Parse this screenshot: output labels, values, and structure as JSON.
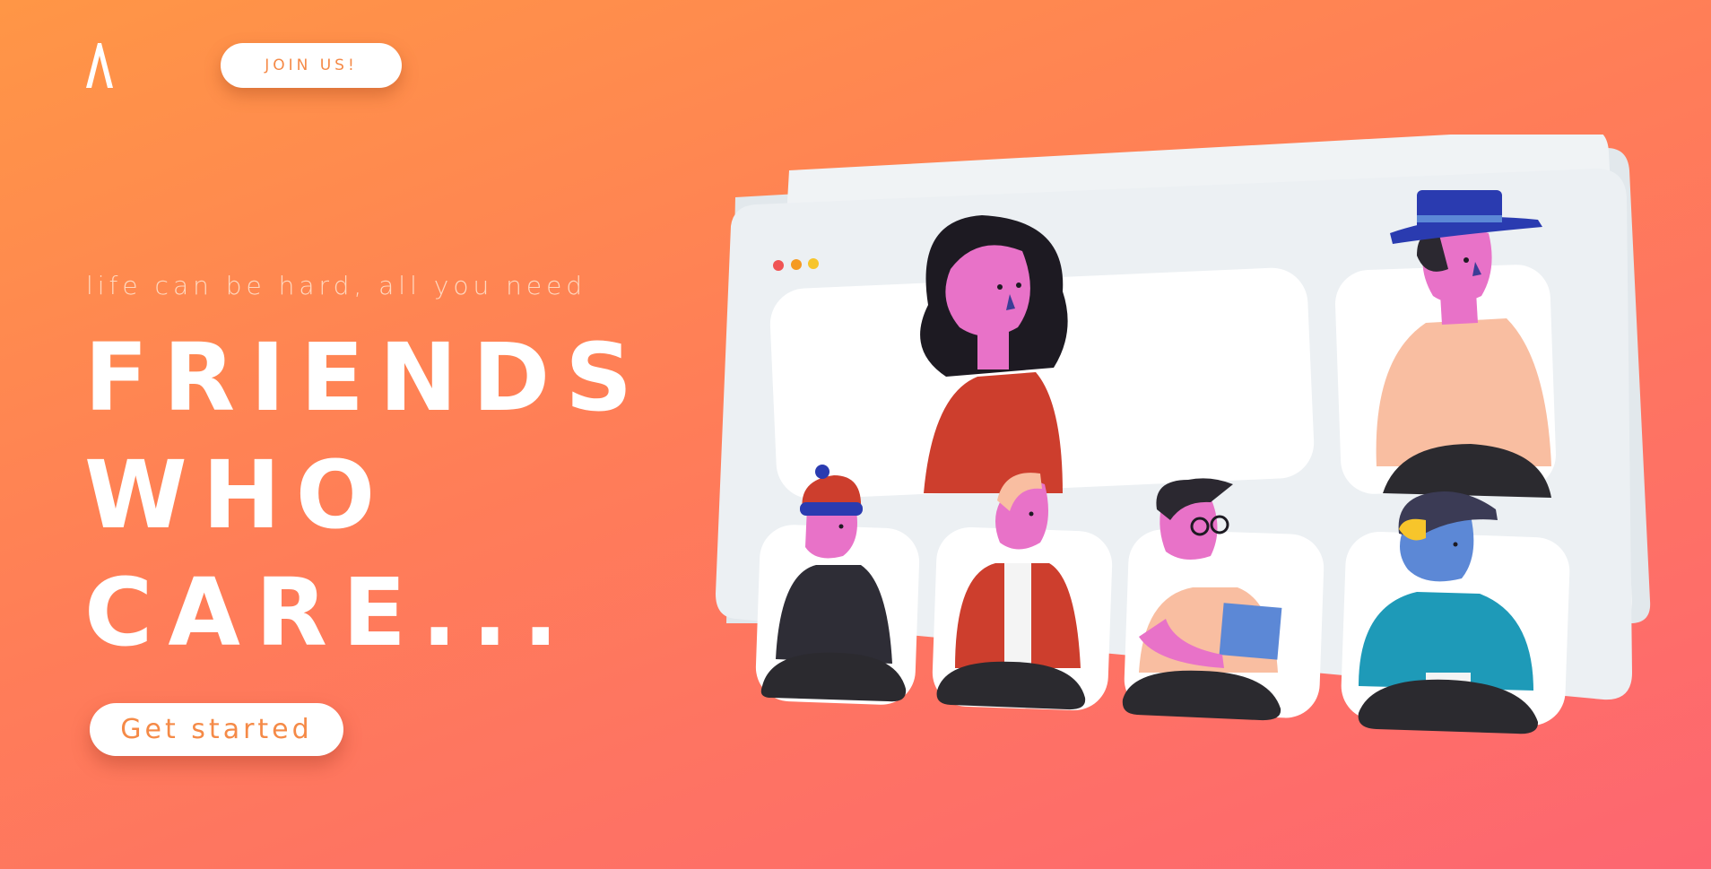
{
  "header": {
    "logo_icon": "triangle-logo-icon",
    "join_label": "JOIN US!"
  },
  "hero": {
    "tagline": "life can be hard, all you need",
    "headline": [
      "FRIENDS",
      "WHO",
      "CARE..."
    ],
    "cta_label": "Get started"
  },
  "illustration": {
    "window_dots": [
      "#f05454",
      "#f59a23",
      "#f7c52b"
    ],
    "participants": [
      "woman-with-dark-hair",
      "man-with-blue-hat",
      "person-with-beanie",
      "bald-man-with-jacket",
      "man-with-glasses-and-tablet",
      "person-with-cap"
    ]
  },
  "colors": {
    "gradient_start": "#ff9646",
    "gradient_end": "#fd6671",
    "accent": "#f58a47",
    "card": "#ecf0f3"
  }
}
